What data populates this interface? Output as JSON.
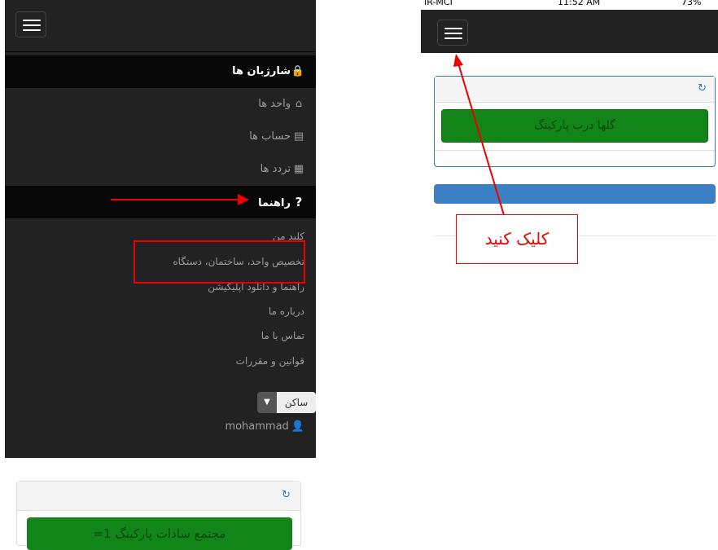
{
  "left_phone": {
    "menu": {
      "items": [
        {
          "label": "شارژبان ها",
          "icon": "lock-icon",
          "glyph": "🔒",
          "active": true
        },
        {
          "label": "واحد ها",
          "icon": "home-icon",
          "glyph": "⌂",
          "active": false
        },
        {
          "label": "حساب ها",
          "icon": "file-invoice-icon",
          "glyph": "▤",
          "active": false
        },
        {
          "label": "تردد ها",
          "icon": "file-icon",
          "glyph": "▦",
          "active": false
        },
        {
          "label": "راهنما",
          "icon": "question-icon",
          "glyph": "?",
          "active": true
        }
      ],
      "help_subitems": [
        "کلید من",
        "تخصیص واحد، ساختمان، دستگاه",
        "راهنما و دانلود اپلیکیشن",
        "درباره ما",
        "تماس با ما",
        "قوانین و مقررات"
      ],
      "role_select": {
        "value": "ساکن",
        "caret": "▼"
      },
      "username": "mohammad",
      "user_icon": "👤"
    },
    "lower_panel": {
      "refresh_icon": "↻",
      "button_label": "مجتمع سادات پارکینگ 1="
    }
  },
  "right_phone": {
    "status": {
      "carrier": "IR-MCI",
      "time": "11:52 AM",
      "battery": "73%"
    },
    "panel": {
      "refresh_icon": "↻",
      "button_label": "گلها درب پارکینگ"
    }
  },
  "annotations": {
    "callout_text": "کلیک کنید",
    "color": "#e00000"
  },
  "colors": {
    "navbar": "#222222",
    "active_menu_bg": "#080808",
    "success_green": "#128518",
    "primary_blue": "#337ab7"
  }
}
